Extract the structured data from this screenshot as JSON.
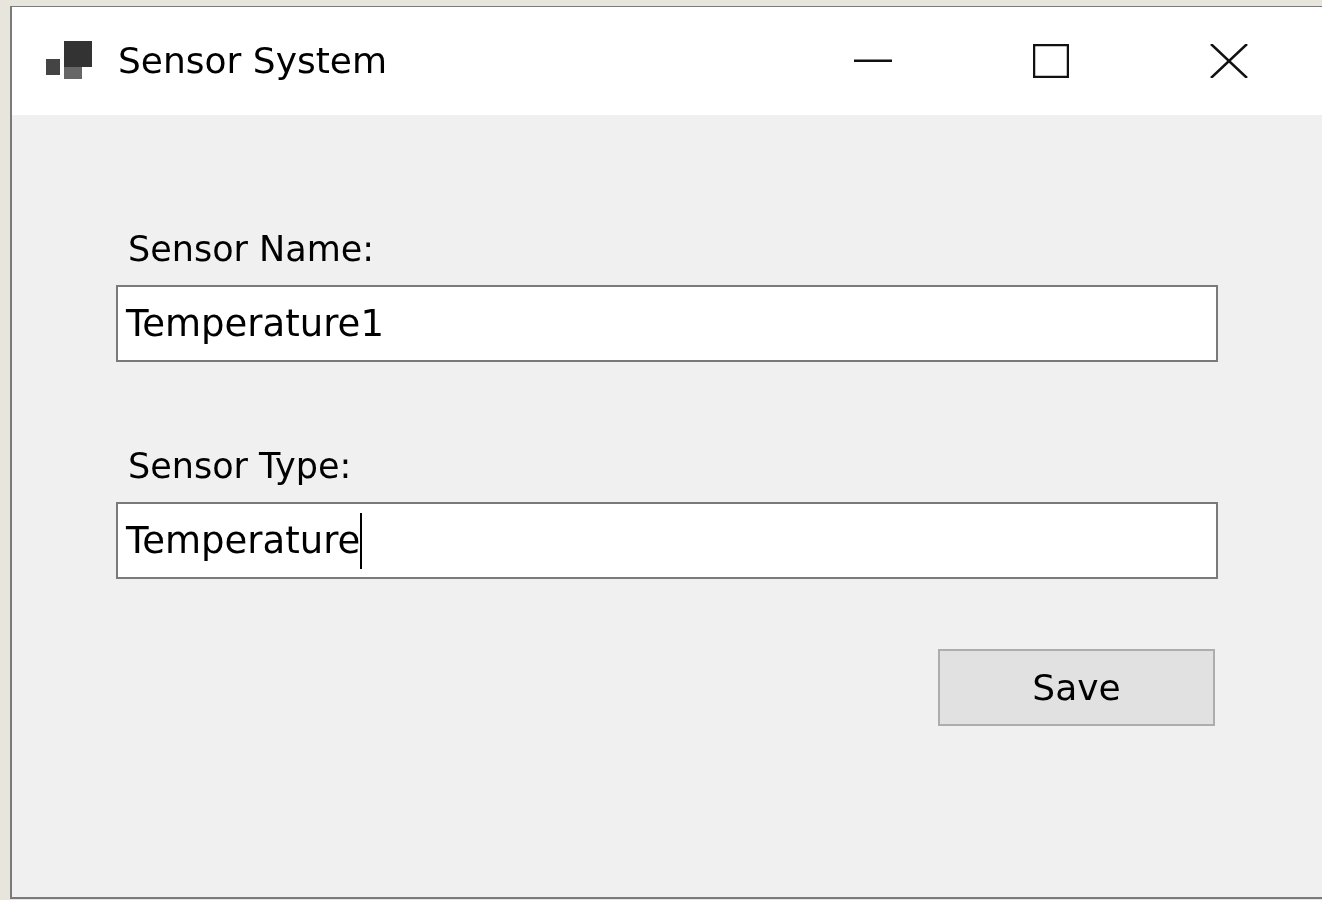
{
  "window": {
    "title": "Sensor System"
  },
  "fields": [
    {
      "label": "Sensor Name:",
      "value": "Temperature1",
      "focused": false
    },
    {
      "label": "Sensor Type:",
      "value": "Temperature",
      "focused": true
    }
  ],
  "buttons": [
    "Save"
  ]
}
